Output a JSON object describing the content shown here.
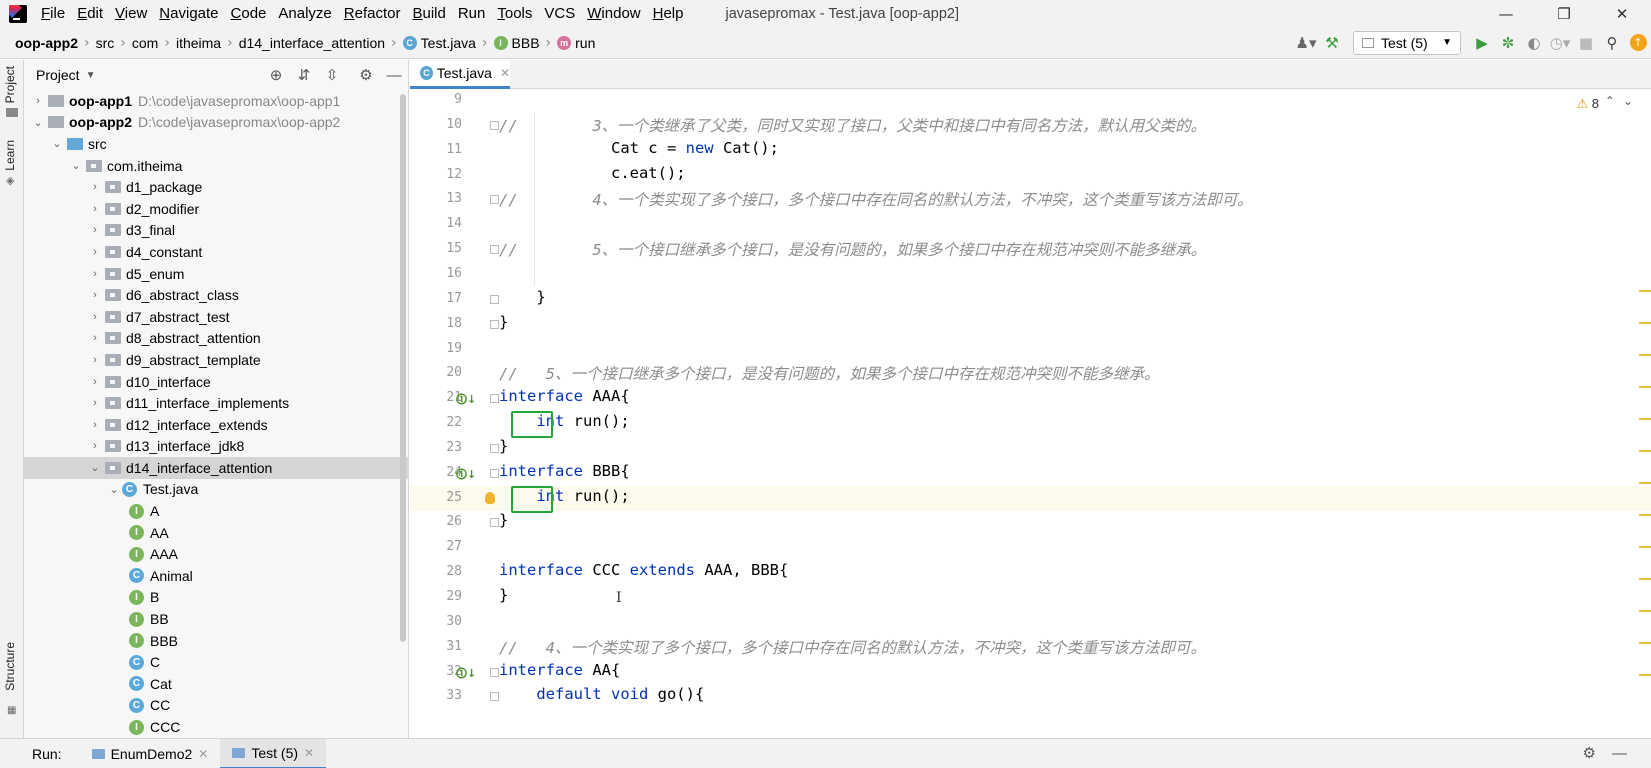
{
  "menu": {
    "items": [
      {
        "mn": "F",
        "rest": "ile"
      },
      {
        "mn": "E",
        "rest": "dit"
      },
      {
        "mn": "V",
        "rest": "iew"
      },
      {
        "mn": "N",
        "rest": "avigate"
      },
      {
        "mn": "C",
        "rest": "ode"
      },
      {
        "mn": "",
        "rest": "Analyze"
      },
      {
        "mn": "R",
        "rest": "efactor"
      },
      {
        "mn": "B",
        "rest": "uild"
      },
      {
        "mn": "",
        "rest": "Run"
      },
      {
        "mn": "T",
        "rest": "ools"
      },
      {
        "mn": "",
        "rest": "VCS"
      },
      {
        "mn": "W",
        "rest": "indow"
      },
      {
        "mn": "H",
        "rest": "elp"
      }
    ],
    "window_title": "javasepromax - Test.java [oop-app2]"
  },
  "breadcrumb": {
    "items": [
      "oop-app2",
      "src",
      "com",
      "itheima",
      "d14_interface_attention",
      "Test.java",
      "BBB",
      "run"
    ]
  },
  "toolbar": {
    "run_config": "Test (5)"
  },
  "left_strip": {
    "project": "Project",
    "learn": "Learn",
    "structure": "Structure"
  },
  "project_panel": {
    "title": "Project",
    "tree": [
      {
        "indent": 0,
        "arrow": "›",
        "type": "folder",
        "label": "oop-app1",
        "bold": true,
        "path": "D:\\code\\javasepromax\\oop-app1"
      },
      {
        "indent": 0,
        "arrow": "⌄",
        "type": "folder",
        "label": "oop-app2",
        "bold": true,
        "path": "D:\\code\\javasepromax\\oop-app2"
      },
      {
        "indent": 1,
        "arrow": "⌄",
        "type": "src",
        "label": "src"
      },
      {
        "indent": 2,
        "arrow": "⌄",
        "type": "pkg",
        "label": "com.itheima"
      },
      {
        "indent": 3,
        "arrow": "›",
        "type": "pkg",
        "label": "d1_package"
      },
      {
        "indent": 3,
        "arrow": "›",
        "type": "pkg",
        "label": "d2_modifier"
      },
      {
        "indent": 3,
        "arrow": "›",
        "type": "pkg",
        "label": "d3_final"
      },
      {
        "indent": 3,
        "arrow": "›",
        "type": "pkg",
        "label": "d4_constant"
      },
      {
        "indent": 3,
        "arrow": "›",
        "type": "pkg",
        "label": "d5_enum"
      },
      {
        "indent": 3,
        "arrow": "›",
        "type": "pkg",
        "label": "d6_abstract_class"
      },
      {
        "indent": 3,
        "arrow": "›",
        "type": "pkg",
        "label": "d7_abstract_test"
      },
      {
        "indent": 3,
        "arrow": "›",
        "type": "pkg",
        "label": "d8_abstract_attention"
      },
      {
        "indent": 3,
        "arrow": "›",
        "type": "pkg",
        "label": "d9_abstract_template"
      },
      {
        "indent": 3,
        "arrow": "›",
        "type": "pkg",
        "label": "d10_interface"
      },
      {
        "indent": 3,
        "arrow": "›",
        "type": "pkg",
        "label": "d11_interface_implements"
      },
      {
        "indent": 3,
        "arrow": "›",
        "type": "pkg",
        "label": "d12_interface_extends"
      },
      {
        "indent": 3,
        "arrow": "›",
        "type": "pkg",
        "label": "d13_interface_jdk8"
      },
      {
        "indent": 3,
        "arrow": "⌄",
        "type": "pkg",
        "label": "d14_interface_attention",
        "selected": true
      },
      {
        "indent": 4,
        "arrow": "⌄",
        "type": "C",
        "label": "Test.java"
      },
      {
        "indent": 5,
        "arrow": "",
        "type": "I",
        "label": "A"
      },
      {
        "indent": 5,
        "arrow": "",
        "type": "I",
        "label": "AA"
      },
      {
        "indent": 5,
        "arrow": "",
        "type": "I",
        "label": "AAA"
      },
      {
        "indent": 5,
        "arrow": "",
        "type": "C",
        "label": "Animal"
      },
      {
        "indent": 5,
        "arrow": "",
        "type": "I",
        "label": "B"
      },
      {
        "indent": 5,
        "arrow": "",
        "type": "I",
        "label": "BB"
      },
      {
        "indent": 5,
        "arrow": "",
        "type": "I",
        "label": "BBB"
      },
      {
        "indent": 5,
        "arrow": "",
        "type": "C",
        "label": "C"
      },
      {
        "indent": 5,
        "arrow": "",
        "type": "C",
        "label": "Cat"
      },
      {
        "indent": 5,
        "arrow": "",
        "type": "C",
        "label": "CC"
      },
      {
        "indent": 5,
        "arrow": "",
        "type": "I",
        "label": "CCC"
      }
    ]
  },
  "editor": {
    "tab_label": "Test.java",
    "warnings": "8",
    "lines": [
      {
        "no": "9",
        "parts": []
      },
      {
        "no": "10",
        "parts": [
          {
            "t": "//        3、一个类继承了父类，同时又实现了接口，父类中和接口中有同名方法，默认用父类的。",
            "c": "cm"
          }
        ],
        "fold": true
      },
      {
        "no": "11",
        "parts": [
          {
            "t": "            Cat c = ",
            "c": ""
          },
          {
            "t": "new",
            "c": "kw"
          },
          {
            "t": " Cat();",
            "c": ""
          }
        ]
      },
      {
        "no": "12",
        "parts": [
          {
            "t": "            c.eat();",
            "c": ""
          }
        ]
      },
      {
        "no": "13",
        "parts": [
          {
            "t": "//        4、一个类实现了多个接口，多个接口中存在同名的默认方法，不冲突，这个类重写该方法即可。",
            "c": "cm"
          }
        ],
        "fold": true
      },
      {
        "no": "14",
        "parts": []
      },
      {
        "no": "15",
        "parts": [
          {
            "t": "//        5、一个接口继承多个接口，是没有问题的，如果多个接口中存在规范冲突则不能多继承。",
            "c": "cm"
          }
        ],
        "fold": true
      },
      {
        "no": "16",
        "parts": []
      },
      {
        "no": "17",
        "parts": [
          {
            "t": "    }",
            "c": ""
          }
        ],
        "fold": true
      },
      {
        "no": "18",
        "parts": [
          {
            "t": "}",
            "c": ""
          }
        ],
        "fold": true
      },
      {
        "no": "19",
        "parts": []
      },
      {
        "no": "20",
        "parts": [
          {
            "t": "//   5、一个接口继承多个接口，是没有问题的，如果多个接口中存在规范冲突则不能多继承。",
            "c": "cm"
          }
        ]
      },
      {
        "no": "21",
        "parts": [
          {
            "t": "interface",
            "c": "kw"
          },
          {
            "t": " AAA{",
            "c": ""
          }
        ],
        "fold": true,
        "impl": true
      },
      {
        "no": "22",
        "parts": [
          {
            "t": "    ",
            "c": ""
          },
          {
            "t": "int",
            "c": "kw"
          },
          {
            "t": " run();",
            "c": ""
          }
        ]
      },
      {
        "no": "23",
        "parts": [
          {
            "t": "}",
            "c": ""
          }
        ],
        "fold": true
      },
      {
        "no": "24",
        "parts": [
          {
            "t": "interface",
            "c": "kw"
          },
          {
            "t": " BBB{",
            "c": ""
          }
        ],
        "fold": true,
        "impl": true
      },
      {
        "no": "25",
        "parts": [
          {
            "t": "    ",
            "c": ""
          },
          {
            "t": "int",
            "c": "kw"
          },
          {
            "t": " run();",
            "c": ""
          }
        ],
        "current": true
      },
      {
        "no": "26",
        "parts": [
          {
            "t": "}",
            "c": ""
          }
        ],
        "fold": true
      },
      {
        "no": "27",
        "parts": []
      },
      {
        "no": "28",
        "parts": [
          {
            "t": "interface",
            "c": "kw"
          },
          {
            "t": " CCC ",
            "c": ""
          },
          {
            "t": "extends",
            "c": "kw"
          },
          {
            "t": " AAA, BBB{",
            "c": ""
          }
        ]
      },
      {
        "no": "29",
        "parts": [
          {
            "t": "}",
            "c": ""
          }
        ]
      },
      {
        "no": "30",
        "parts": []
      },
      {
        "no": "31",
        "parts": [
          {
            "t": "//   4、一个类实现了多个接口，多个接口中存在同名的默认方法，不冲突，这个类重写该方法即可。",
            "c": "cm"
          }
        ]
      },
      {
        "no": "32",
        "parts": [
          {
            "t": "interface",
            "c": "kw"
          },
          {
            "t": " AA{",
            "c": ""
          }
        ],
        "fold": true,
        "impl": true
      },
      {
        "no": "33",
        "parts": [
          {
            "t": "    ",
            "c": ""
          },
          {
            "t": "default void",
            "c": "kw"
          },
          {
            "t": " go(){",
            "c": ""
          }
        ],
        "fold": true
      }
    ]
  },
  "bottom_bar": {
    "run_label": "Run:",
    "tabs": [
      {
        "label": "EnumDemo2",
        "active": false
      },
      {
        "label": "Test (5)",
        "active": true
      }
    ]
  }
}
